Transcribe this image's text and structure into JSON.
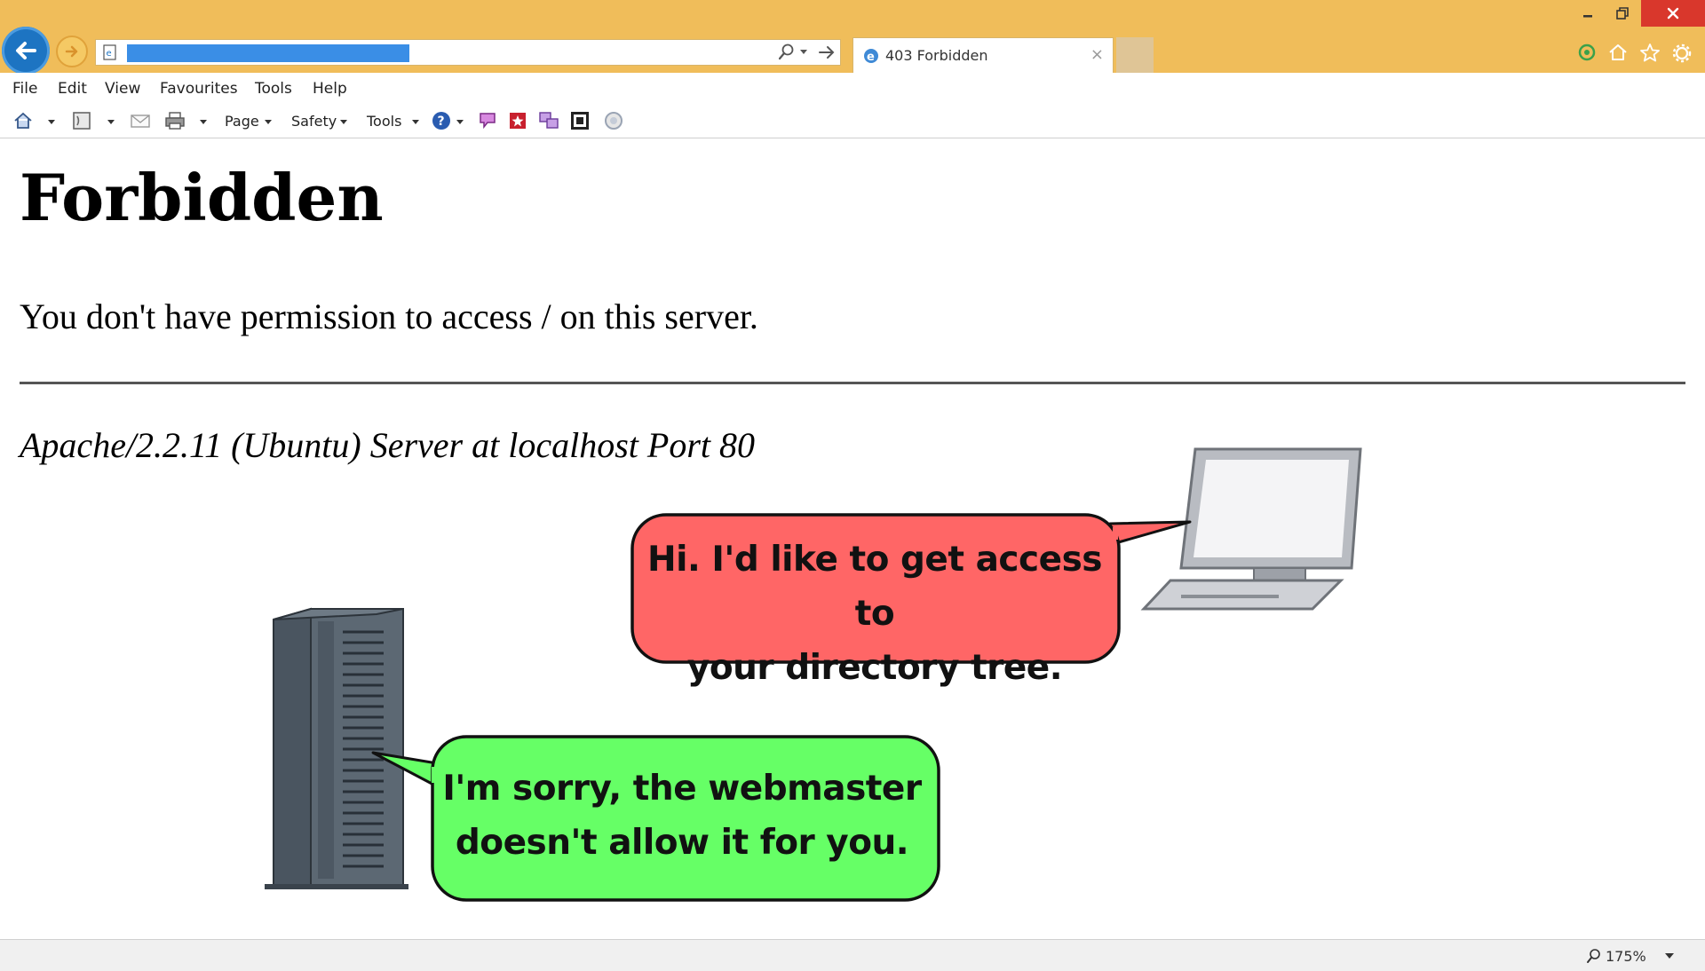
{
  "browser": {
    "address_selected": true,
    "tab_title": "403 Forbidden",
    "tab_close_glyph": "×",
    "window_controls": {
      "minimize": "–",
      "restore": "❐",
      "close": "✕"
    },
    "accent_colors": {
      "frame": "#f0bd5a",
      "back_button": "#1d74c2",
      "close_button": "#d9372c",
      "selection": "#3a8ee6"
    }
  },
  "menu": {
    "items": [
      "File",
      "Edit",
      "View",
      "Favourites",
      "Tools",
      "Help"
    ]
  },
  "command_bar": {
    "page_label": "Page",
    "safety_label": "Safety",
    "tools_label": "Tools",
    "icons": [
      "home-icon",
      "feeds-icon",
      "mail-icon",
      "print-icon",
      "help-icon",
      "addon-icon-1",
      "addon-icon-2",
      "addon-icon-3",
      "addon-icon-4",
      "addon-icon-5"
    ]
  },
  "page": {
    "heading": "Forbidden",
    "message": "You don't have permission to access / on this server.",
    "server_signature": "Apache/2.2.11 (Ubuntu) Server at localhost Port 80"
  },
  "illustration": {
    "client_bubble_line1": "Hi. I'd like to get access to",
    "client_bubble_line2": "your directory tree.",
    "server_bubble_line1": "I'm sorry, the webmaster",
    "server_bubble_line2": "doesn't allow it for you.",
    "client_bubble_color": "#ff6666",
    "server_bubble_color": "#66ff66"
  },
  "status_bar": {
    "zoom": "175%"
  }
}
